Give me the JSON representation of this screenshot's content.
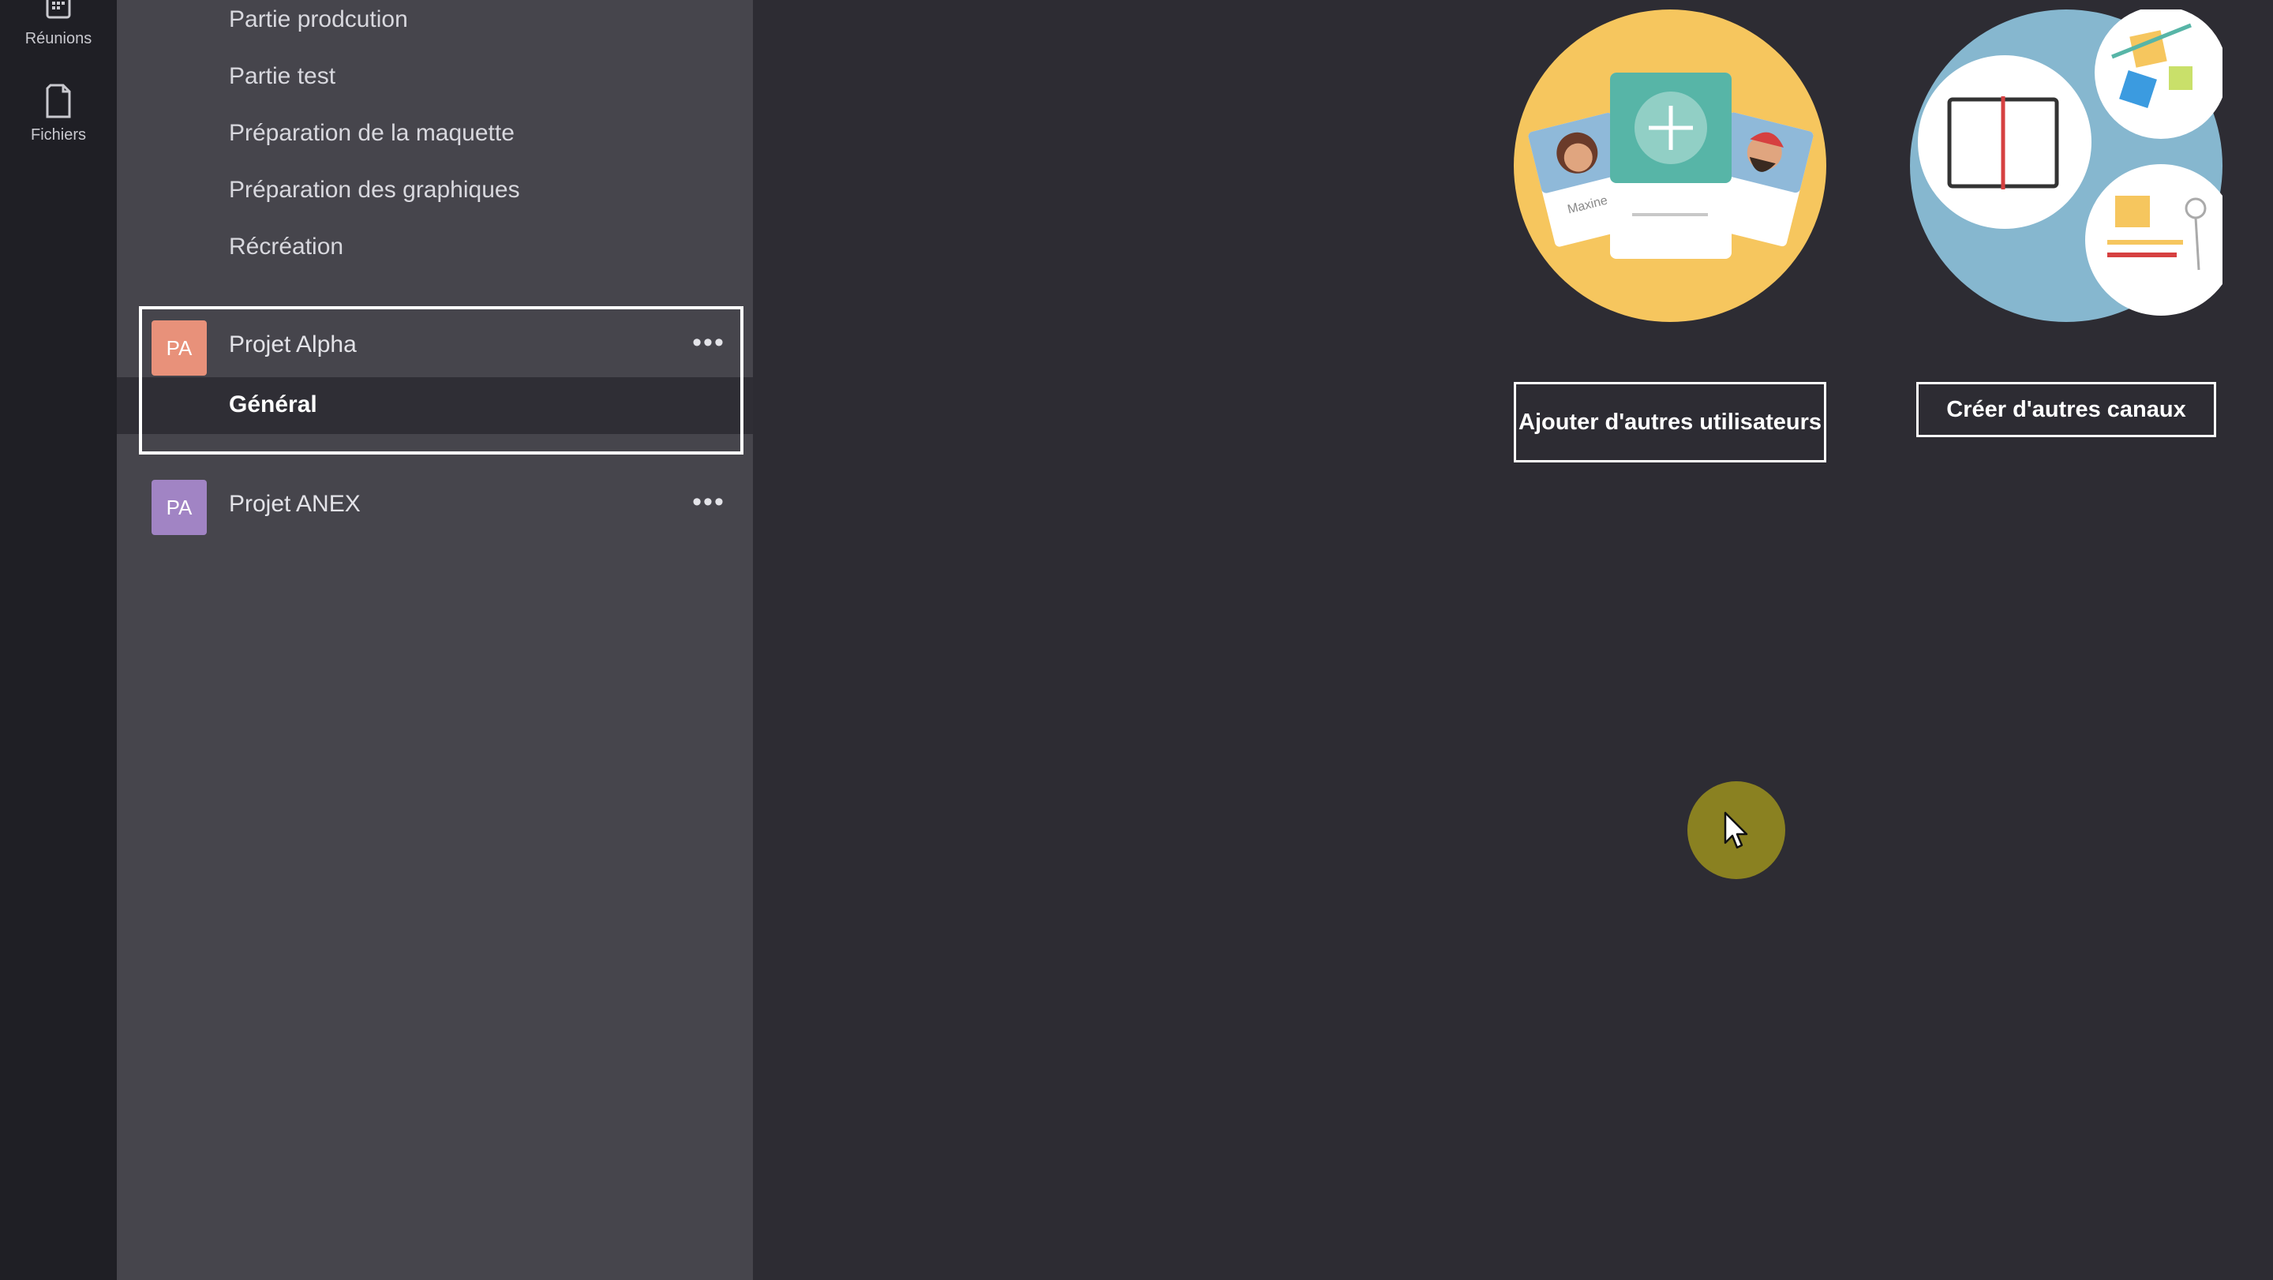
{
  "appbar": {
    "items": [
      {
        "label": "Réunions",
        "icon": "calendar-icon"
      },
      {
        "label": "Fichiers",
        "icon": "file-icon"
      }
    ]
  },
  "channels": {
    "previous_team_channels": [
      "Partie prodcution",
      "Partie test",
      "Préparation de la maquette",
      "Préparation des graphiques",
      "Récréation"
    ],
    "teams": [
      {
        "initials": "PA",
        "name": "Projet Alpha",
        "more": "•••",
        "color": "#e8917a",
        "channels": [
          "Général"
        ]
      },
      {
        "initials": "PA",
        "name": "Projet ANEX",
        "more": "•••",
        "color": "#a184c4",
        "channels": []
      }
    ]
  },
  "main": {
    "add_users_button": "Ajouter d'autres utilisateurs",
    "create_channels_button": "Créer d'autres canaux",
    "illustration_label": "Maxine"
  },
  "colors": {
    "appbar_bg": "#1f1f25",
    "panel_bg": "#46454c",
    "main_bg": "#2d2c33",
    "highlight": "#ffffff",
    "cursor_dot": "#8a8121"
  }
}
